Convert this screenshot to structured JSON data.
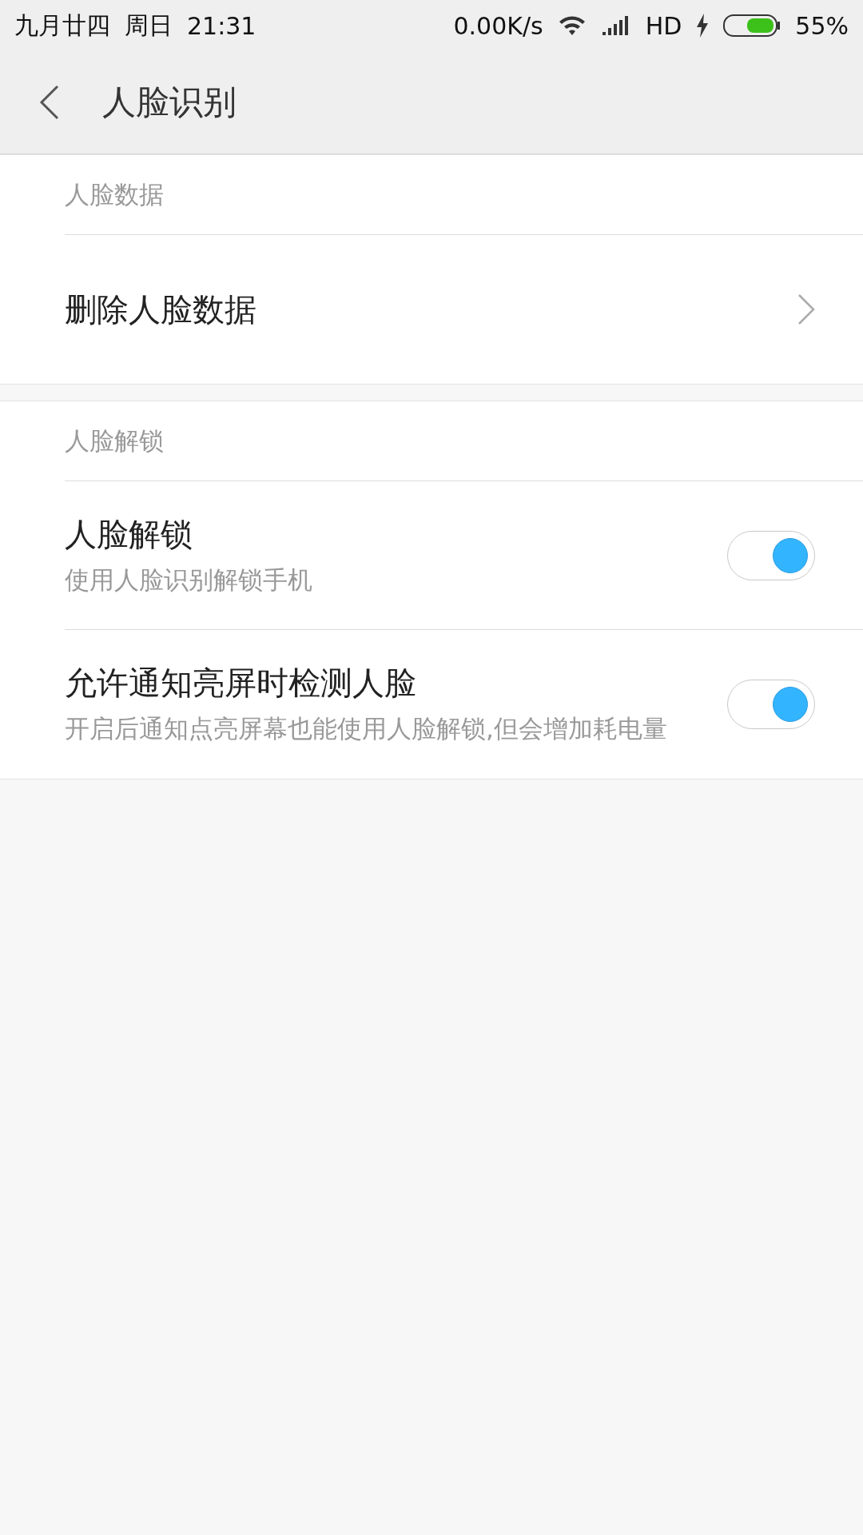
{
  "status_bar": {
    "date": "九月廿四",
    "weekday": "周日",
    "time": "21:31",
    "speed": "0.00K/s",
    "network": "HD",
    "battery": "55%"
  },
  "header": {
    "title": "人脸识别"
  },
  "sections": [
    {
      "title": "人脸数据",
      "items": [
        {
          "kind": "link",
          "title": "删除人脸数据"
        }
      ]
    },
    {
      "title": "人脸解锁",
      "items": [
        {
          "kind": "toggle",
          "title": "人脸解锁",
          "subtitle": "使用人脸识别解锁手机",
          "on": true
        },
        {
          "kind": "toggle",
          "title": "允许通知亮屏时检测人脸",
          "subtitle": "开启后通知点亮屏幕也能使用人脸解锁,但会增加耗电量",
          "on": true
        }
      ]
    }
  ]
}
